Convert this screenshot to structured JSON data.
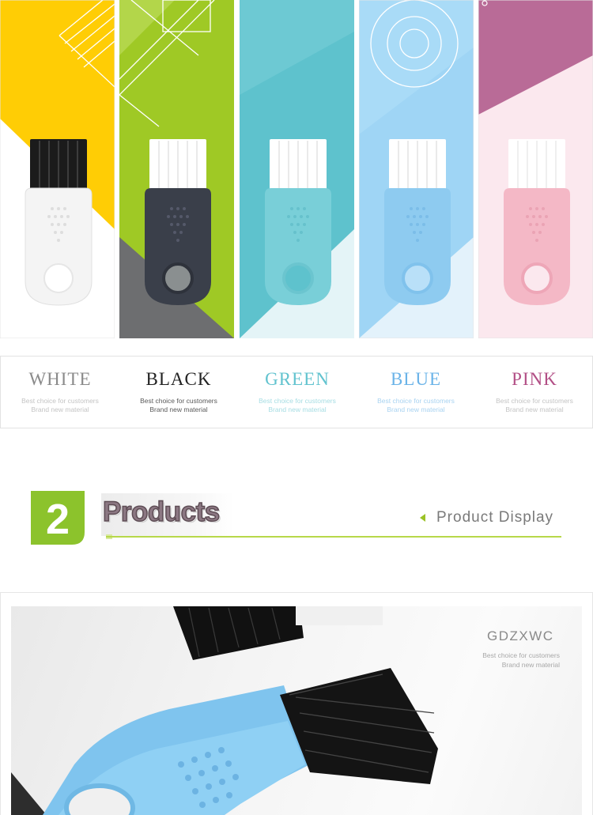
{
  "colors": {
    "white": {
      "name": "WHITE",
      "text": "#8a8a8a",
      "handle": "#f4f4f4",
      "bristle": "#1b1b1b"
    },
    "black": {
      "name": "BLACK",
      "text": "#222222",
      "handle": "#3a3f4a",
      "bristle": "#ffffff"
    },
    "green": {
      "name": "GREEN",
      "text": "#62c3cf",
      "handle": "#79cfd8",
      "bristle": "#ffffff"
    },
    "blue": {
      "name": "BLUE",
      "text": "#6ab3e8",
      "handle": "#8ecbf0",
      "bristle": "#ffffff"
    },
    "pink": {
      "name": "PINK",
      "text": "#b24f86",
      "handle": "#f4b8c6",
      "bristle": "#ffffff"
    }
  },
  "labels": {
    "line1": "Best choice for customers",
    "line2": "Brand new material"
  },
  "section": {
    "number": "2",
    "title": "Products",
    "display": "Product Display",
    "accent": "#8cc32c"
  },
  "photo": {
    "brand": "GDZXWC",
    "line1": "Best choice for customers",
    "line2": "Brand new material"
  }
}
